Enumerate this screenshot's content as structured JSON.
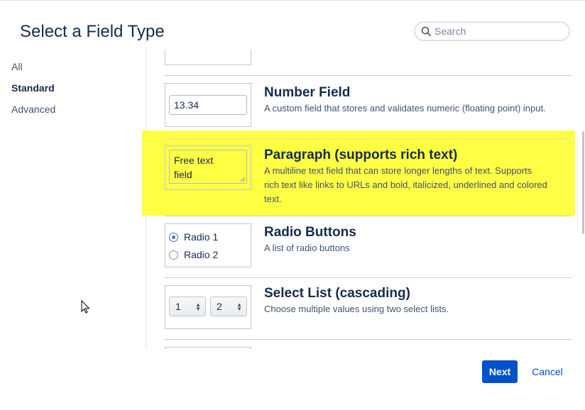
{
  "dialog": {
    "title": "Select a Field Type",
    "search_placeholder": "Search"
  },
  "nav": {
    "items": [
      {
        "label": "All",
        "active": false
      },
      {
        "label": "Standard",
        "active": true
      },
      {
        "label": "Advanced",
        "active": false
      }
    ]
  },
  "fields": [
    {
      "name": "Number Field",
      "description": "A custom field that stores and validates numeric (floating point) input.",
      "preview_value": "13.34"
    },
    {
      "name": "Paragraph (supports rich text)",
      "description": "A multiline text field that can store longer lengths of text. Supports rich text like links to URLs and bold, italicized, underlined and colored text.",
      "preview_line1": "Free text",
      "preview_line2": "field",
      "highlighted": true,
      "highlight_color": "#ffff44"
    },
    {
      "name": "Radio Buttons",
      "description": "A list of radio buttons",
      "preview_options": [
        "Radio 1",
        "Radio 2"
      ]
    },
    {
      "name": "Select List (cascading)",
      "description": "Choose multiple values using two select lists.",
      "preview_select1": "1",
      "preview_select2": "2"
    }
  ],
  "footer": {
    "next_label": "Next",
    "cancel_label": "Cancel"
  },
  "colors": {
    "primary": "#0052cc",
    "highlight": "#ffff44",
    "text": "#172b4d"
  }
}
